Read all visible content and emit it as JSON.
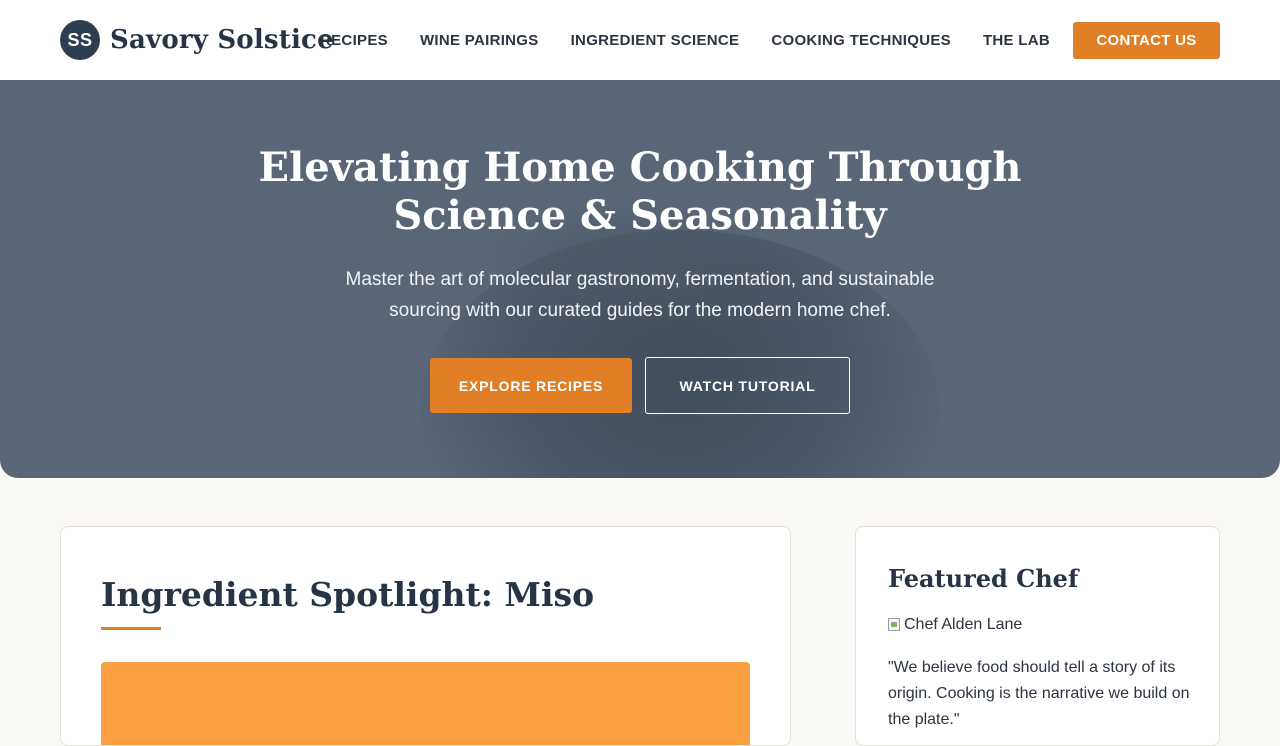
{
  "header": {
    "logo_initials": "SS",
    "logo_text": "Savory Solstice",
    "nav": [
      "RECIPES",
      "WINE PAIRINGS",
      "INGREDIENT SCIENCE",
      "COOKING TECHNIQUES",
      "THE LAB"
    ],
    "contact_label": "CONTACT US"
  },
  "hero": {
    "title": "Elevating Home Cooking Through Science & Seasonality",
    "subtitle": "Master the art of molecular gastronomy, fermentation, and sustainable sourcing with our curated guides for the modern home chef.",
    "primary_cta": "EXPLORE RECIPES",
    "secondary_cta": "WATCH TUTORIAL"
  },
  "spotlight": {
    "title": "Ingredient Spotlight: Miso"
  },
  "featured_chef": {
    "heading": "Featured Chef",
    "image_alt": "Chef Alden Lane",
    "quote": "\"We believe food should tell a story of its origin. Cooking is the narrative we build on the plate.\""
  },
  "colors": {
    "accent": "#e07f25",
    "navy": "#2c3e50",
    "hero_overlay": "#5a6676",
    "spotlight_image": "#fb9f43"
  }
}
